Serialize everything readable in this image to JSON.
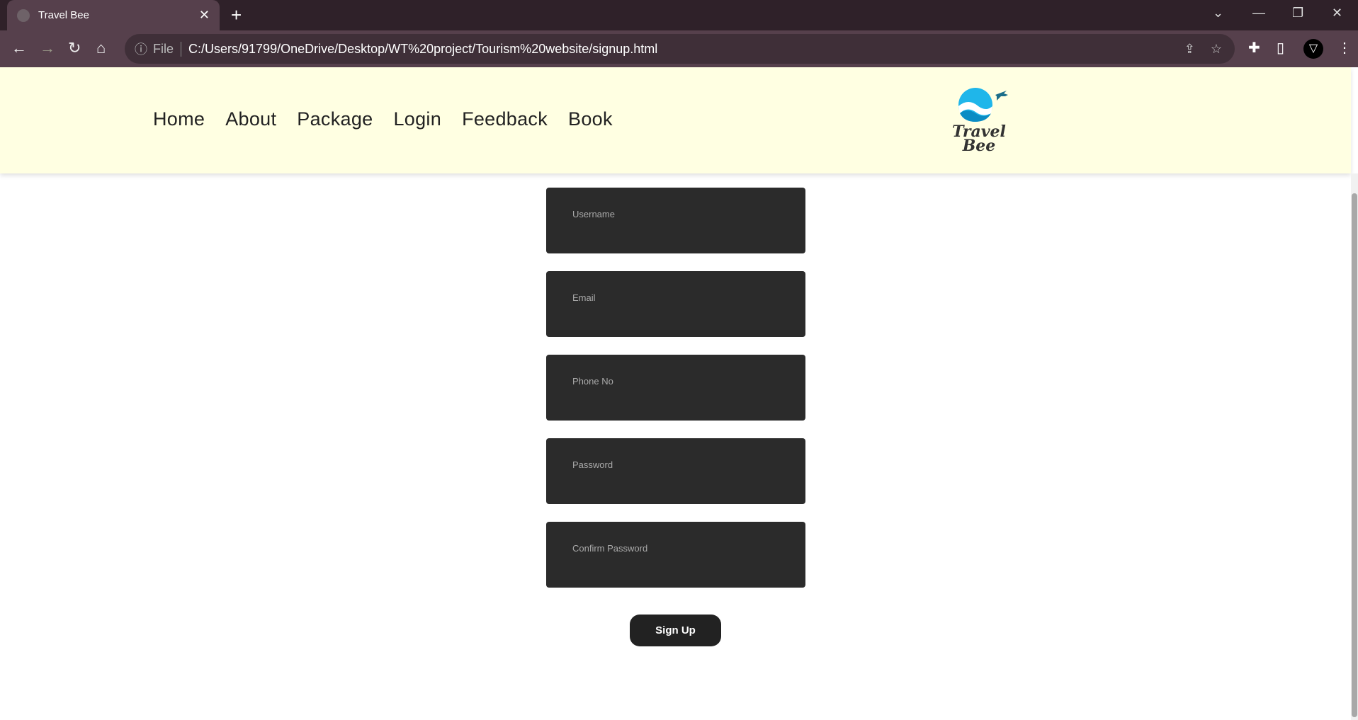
{
  "browser": {
    "tab_title": "Travel Bee",
    "address_prefix": "File",
    "url": "C:/Users/91799/OneDrive/Desktop/WT%20project/Tourism%20website/signup.html"
  },
  "nav": {
    "items": [
      "Home",
      "About",
      "Package",
      "Login",
      "Feedback",
      "Book"
    ]
  },
  "logo": {
    "line1": "Travel",
    "line2": "Bee"
  },
  "form": {
    "username": "Username",
    "email": "Email",
    "phone": "Phone No",
    "password": "Password",
    "confirm": "Confirm Password",
    "submit": "Sign Up"
  },
  "colors": {
    "header_bg": "#ffffe2",
    "field_bg": "#2b2b2b",
    "button_bg": "#222222",
    "logo_blue": "#1fb6ea"
  }
}
